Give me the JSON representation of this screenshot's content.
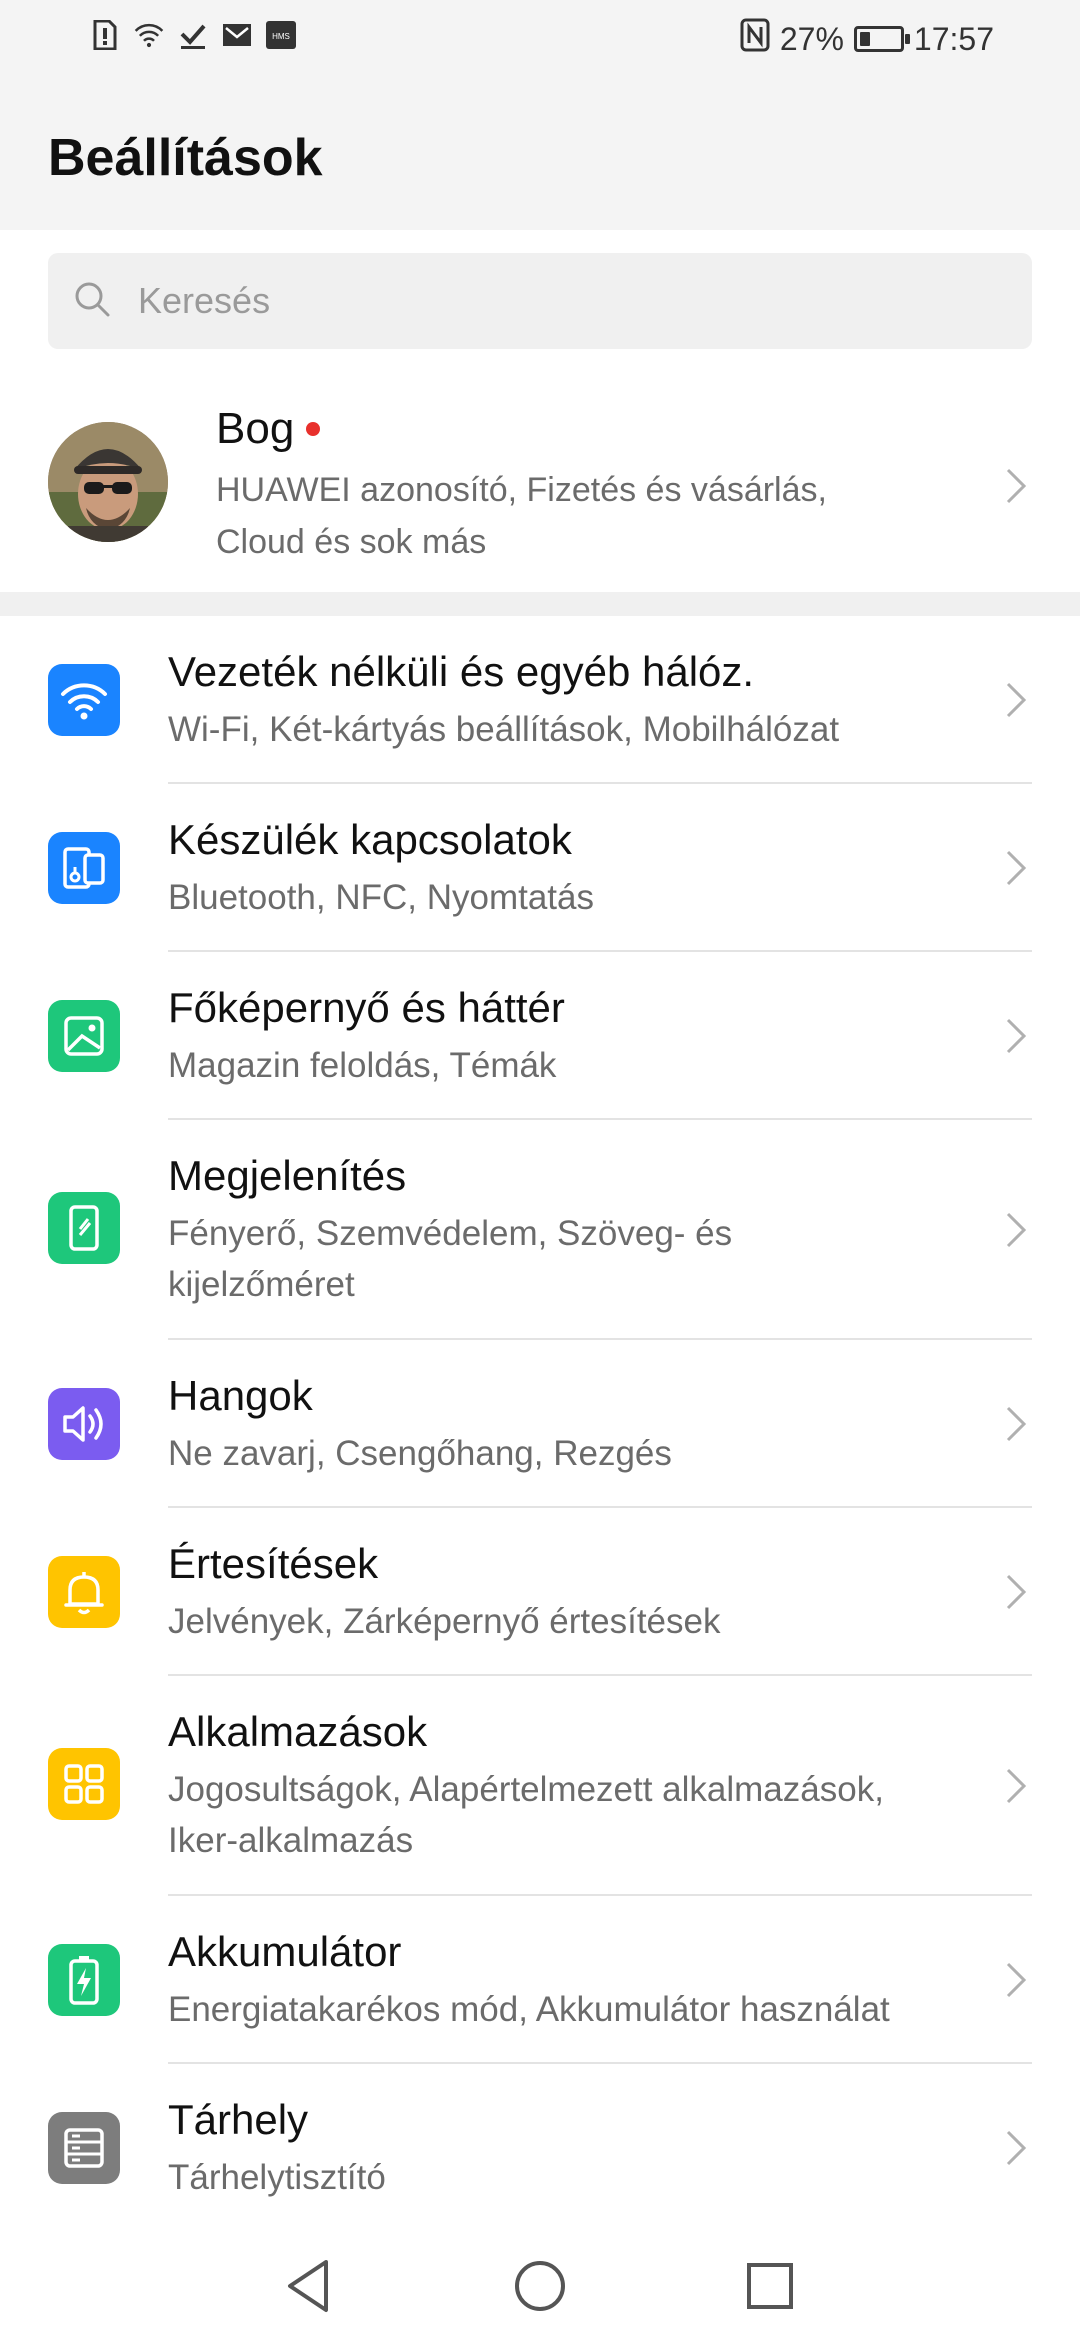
{
  "status_bar": {
    "left_icons": [
      "alert-icon",
      "wifi-signal-icon",
      "download-done-icon",
      "mail-icon",
      "hms-icon"
    ],
    "nfc": "N",
    "battery_percent": "27%",
    "battery_level": 0.27,
    "time": "17:57"
  },
  "header": {
    "title": "Beállítások"
  },
  "search": {
    "placeholder": "Keresés"
  },
  "account": {
    "name": "Bog",
    "subtitle_line1": "HUAWEI azonosító, Fizetés és vásárlás,",
    "subtitle_line2": "Cloud és sok más"
  },
  "items": [
    {
      "title": "Vezeték nélküli és egyéb hálóz.",
      "sub1": "Wi-Fi, Két-kártyás beállítások, Mobilhálózat",
      "sub2": "",
      "color": "#1a84ff",
      "icon": "wifi-icon"
    },
    {
      "title": "Készülék kapcsolatok",
      "sub1": "Bluetooth, NFC, Nyomtatás",
      "sub2": "",
      "color": "#1a84ff",
      "icon": "device-connection-icon"
    },
    {
      "title": "Főképernyő és háttér",
      "sub1": "Magazin feloldás, Témák",
      "sub2": "",
      "color": "#1ec77b",
      "icon": "wallpaper-icon"
    },
    {
      "title": "Megjelenítés",
      "sub1": "Fényerő, Szemvédelem, Szöveg- és",
      "sub2": "kijelzőméret",
      "color": "#1ec77b",
      "icon": "display-icon"
    },
    {
      "title": "Hangok",
      "sub1": "Ne zavarj, Csengőhang, Rezgés",
      "sub2": "",
      "color": "#7b5cf0",
      "icon": "speaker-icon"
    },
    {
      "title": "Értesítések",
      "sub1": "Jelvények, Zárképernyő értesítések",
      "sub2": "",
      "color": "#ffc400",
      "icon": "bell-icon"
    },
    {
      "title": "Alkalmazások",
      "sub1": "Jogosultságok, Alapértelmezett alkalmazások,",
      "sub2": "Iker-alkalmazás",
      "color": "#ffc400",
      "icon": "apps-grid-icon"
    },
    {
      "title": "Akkumulátor",
      "sub1": "Energiatakarékos mód, Akkumulátor használat",
      "sub2": "",
      "color": "#1ec77b",
      "icon": "battery-icon"
    },
    {
      "title": "Tárhely",
      "sub1": "Tárhelytisztító",
      "sub2": "",
      "color": "#7d7d7d",
      "icon": "storage-icon"
    }
  ],
  "nav": {
    "back": "back-icon",
    "home": "home-icon",
    "recents": "recents-icon"
  }
}
